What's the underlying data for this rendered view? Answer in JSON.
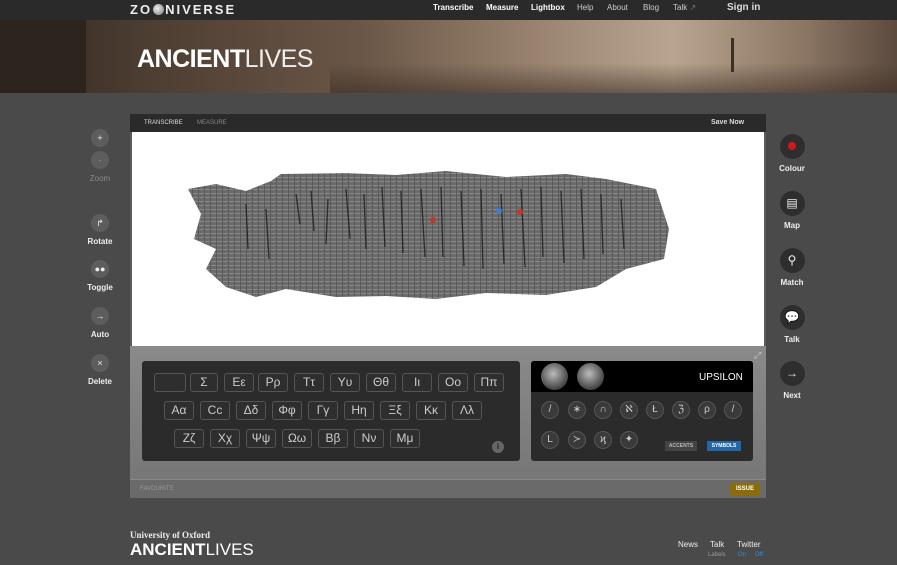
{
  "topbar": {
    "logo_left": "ZO",
    "logo_right": "NIVERSE",
    "nav": [
      "Transcribe",
      "Measure",
      "Lightbox",
      "Help",
      "About",
      "Blog",
      "Talk"
    ],
    "sign_in": "Sign in"
  },
  "banner": {
    "title_bold": "ANCIENT",
    "title_light": "LIVES"
  },
  "left_controls": {
    "zoom_in": "+",
    "zoom_out": "-",
    "zoom": "Zoom",
    "rotate": "Rotate",
    "toggle": "Toggle",
    "auto": "Auto",
    "delete": "Delete"
  },
  "right_controls": {
    "colour": "Colour",
    "map": "Map",
    "match": "Match",
    "talk": "Talk",
    "next": "Next"
  },
  "panel": {
    "tab_transcribe": "TRANSCRIBE",
    "tab_measure": "MEASURE",
    "save": "Save Now",
    "favourite": "FAVOURITE",
    "issue": "ISSUE"
  },
  "keyboard": {
    "row1": [
      "Σ",
      "Εε",
      "Ρρ",
      "Ττ",
      "Υυ",
      "Θθ",
      "Ιι",
      "Οο",
      "Ππ"
    ],
    "row2": [
      "Αα",
      "Cc",
      "Δδ",
      "Φφ",
      "Γγ",
      "Ηη",
      "Ξξ",
      "Κκ",
      "Λλ"
    ],
    "row3": [
      "Ζζ",
      "Χχ",
      "Ψψ",
      "Ωω",
      "Ββ",
      "Νν",
      "Μμ"
    ],
    "info": "i"
  },
  "symbols_panel": {
    "letter_name": "UPSILON",
    "symbols_row1": [
      "/",
      "∗",
      "∩",
      "ℵ",
      "Ł",
      "ℨ",
      "ρ",
      "/"
    ],
    "symbols_row2": [
      "L",
      "≻",
      "ϗ",
      "✦"
    ],
    "accents_tab": "ACCENTS",
    "symbols_tab": "SYMBOLS"
  },
  "footer": {
    "university": "University of Oxford",
    "title_bold": "ANCIENT",
    "title_light": "LIVES",
    "links": [
      "News",
      "Talk",
      "Twitter"
    ],
    "labels": "Labels",
    "on": "On",
    "off": "Off"
  },
  "colors": {
    "accent_red": "#d11a1a",
    "issue": "#8a6d0a",
    "symbols_tab": "#2268a8"
  }
}
